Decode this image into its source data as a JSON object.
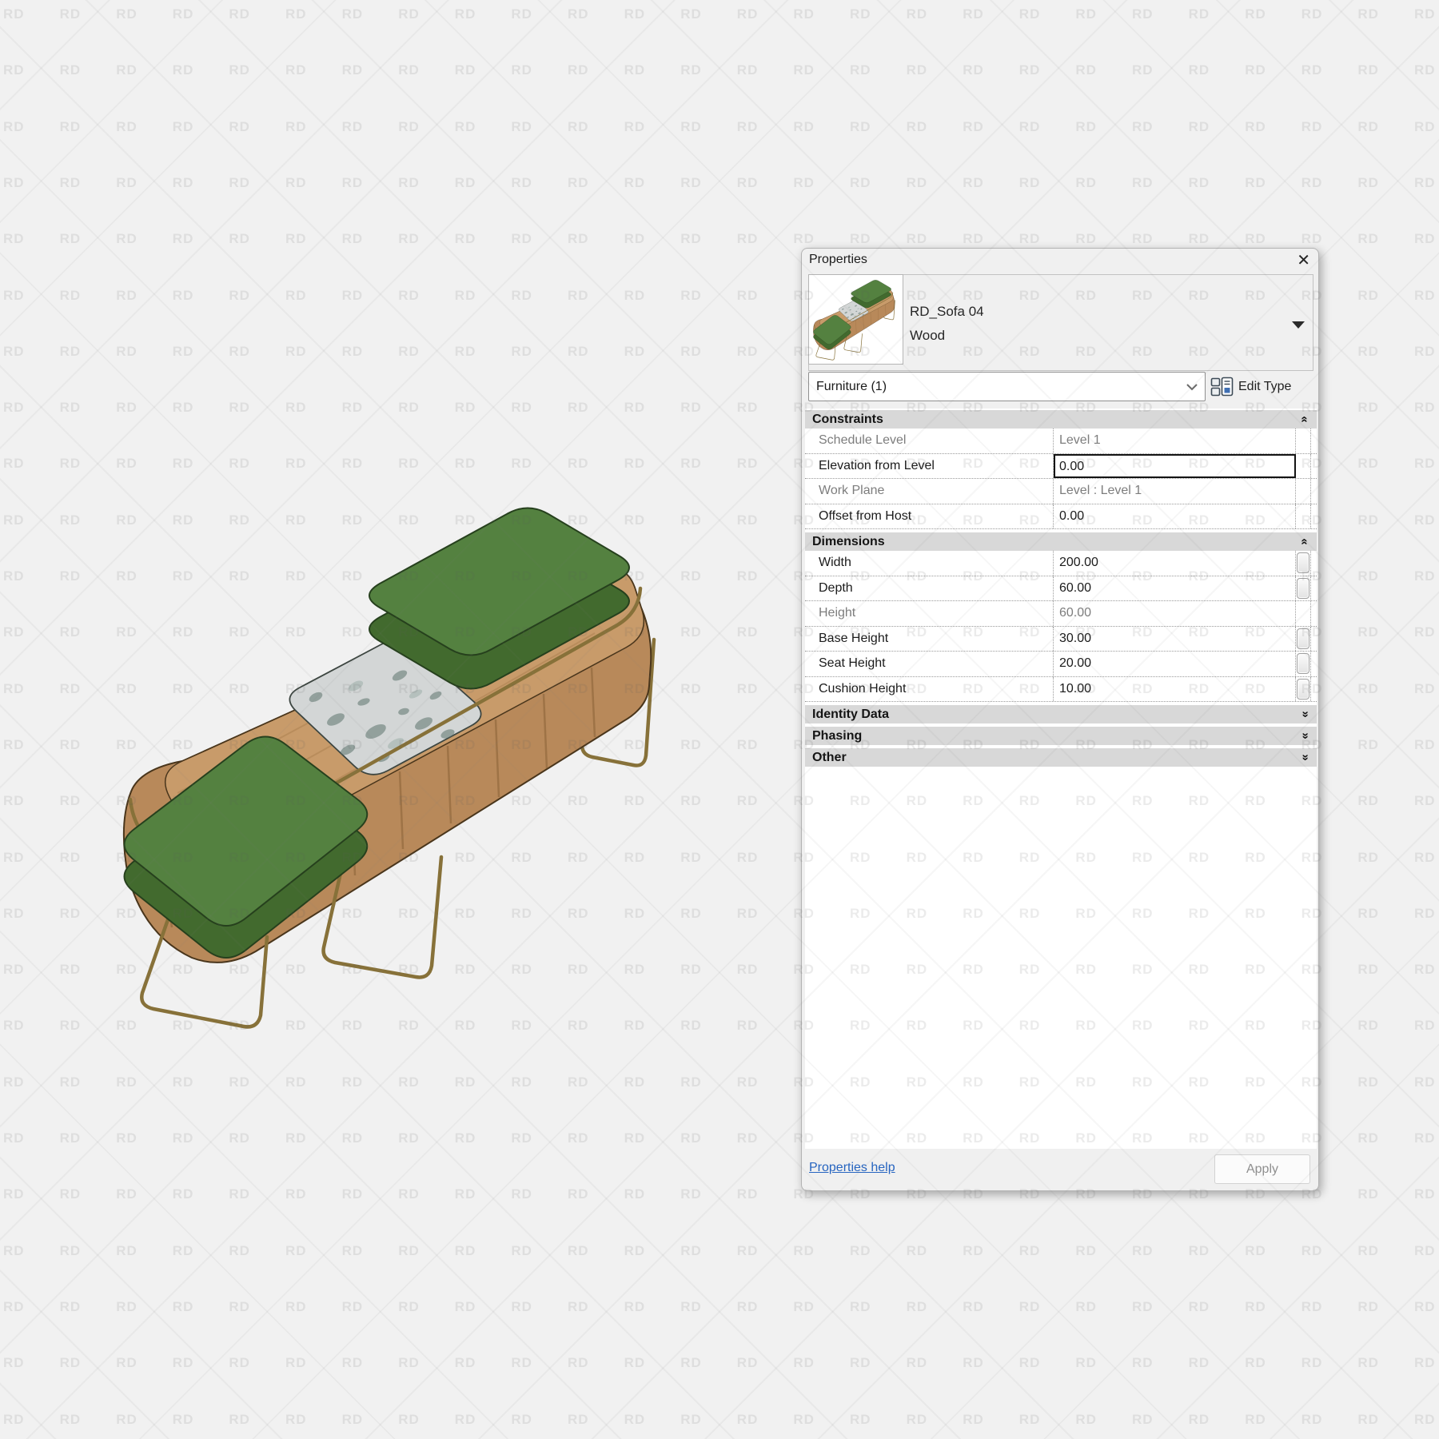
{
  "watermark": {
    "text": "RD"
  },
  "render": {
    "description": "isometric 3d render of wooden bench with two green cushions and marble tray"
  },
  "panel": {
    "title": "Properties",
    "close_icon": "✕",
    "preview": {
      "type_name": "RD_Sofa 04",
      "type_family": "Wood"
    },
    "selector": {
      "value": "Furniture (1)",
      "edit_type_label": "Edit Type"
    },
    "sections": [
      {
        "label": "Constraints",
        "expanded": true,
        "rows": [
          {
            "label": "Schedule Level",
            "value": "Level 1",
            "readonly": true,
            "selected": false,
            "param": false
          },
          {
            "label": "Elevation from Level",
            "value": "0.00",
            "readonly": false,
            "selected": true,
            "param": false
          },
          {
            "label": "Work Plane",
            "value": "Level : Level 1",
            "readonly": true,
            "selected": false,
            "param": false
          },
          {
            "label": "Offset from Host",
            "value": "0.00",
            "readonly": false,
            "selected": false,
            "param": false
          }
        ]
      },
      {
        "label": "Dimensions",
        "expanded": true,
        "rows": [
          {
            "label": "Width",
            "value": "200.00",
            "readonly": false,
            "selected": false,
            "param": true
          },
          {
            "label": "Depth",
            "value": "60.00",
            "readonly": false,
            "selected": false,
            "param": true
          },
          {
            "label": "Height",
            "value": "60.00",
            "readonly": true,
            "selected": false,
            "param": false
          },
          {
            "label": "Base Height",
            "value": "30.00",
            "readonly": false,
            "selected": false,
            "param": true
          },
          {
            "label": "Seat Height",
            "value": "20.00",
            "readonly": false,
            "selected": false,
            "param": true
          },
          {
            "label": "Cushion Height",
            "value": "10.00",
            "readonly": false,
            "selected": false,
            "param": true
          }
        ]
      },
      {
        "label": "Identity Data",
        "expanded": false,
        "rows": []
      },
      {
        "label": "Phasing",
        "expanded": false,
        "rows": []
      },
      {
        "label": "Other",
        "expanded": false,
        "rows": []
      }
    ],
    "footer": {
      "help_label": "Properties help",
      "apply_label": "Apply"
    }
  },
  "colors": {
    "green-top": "#548140",
    "green-side": "#426a2e",
    "wood-top": "#c89b6a",
    "wood-side": "#b8895a",
    "marble": "#d3d6d6",
    "wire": "#877139",
    "band": "#d8d8d8",
    "link": "#2765c0"
  }
}
